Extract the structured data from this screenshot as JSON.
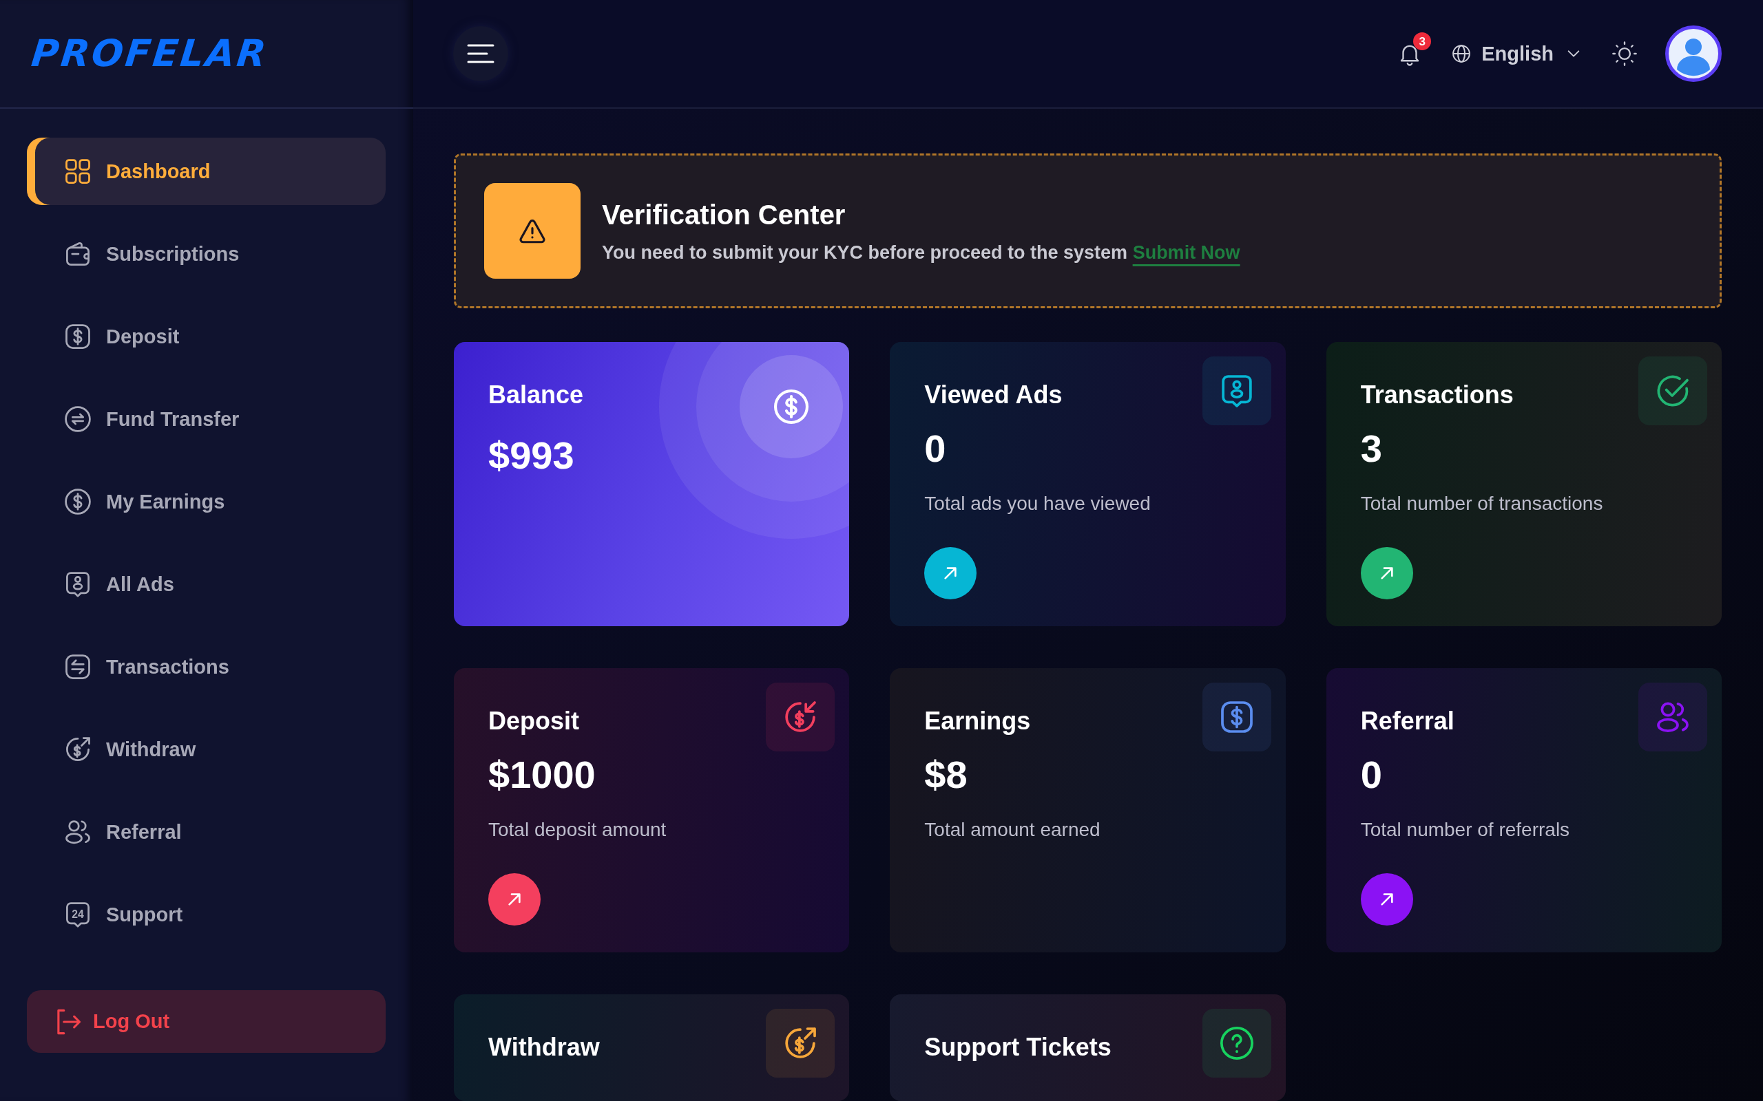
{
  "sidebar": {
    "logo": "PROFELAR",
    "items": [
      {
        "label": "Dashboard",
        "selected": true
      },
      {
        "label": "Subscriptions",
        "selected": false
      },
      {
        "label": "Deposit",
        "selected": false
      },
      {
        "label": "Fund Transfer",
        "selected": false
      },
      {
        "label": "My Earnings",
        "selected": false
      },
      {
        "label": "All Ads",
        "selected": false
      },
      {
        "label": "Transactions",
        "selected": false
      },
      {
        "label": "Withdraw",
        "selected": false
      },
      {
        "label": "Referral",
        "selected": false
      },
      {
        "label": "Support",
        "selected": false,
        "icon_text": "24"
      }
    ],
    "logout": "Log Out"
  },
  "topbar": {
    "notification_count": "3",
    "language": "English"
  },
  "verification": {
    "title": "Verification Center",
    "message": "You need to submit your KYC before proceed to the system",
    "link": "Submit Now"
  },
  "cards": [
    {
      "kind": "balance",
      "title": "Balance",
      "value": "$993"
    },
    {
      "kind": "stat",
      "title": "Viewed Ads",
      "value": "0",
      "description": "Total ads you have viewed",
      "color": "#06b6d4",
      "arrow_button": true
    },
    {
      "kind": "stat",
      "title": "Transactions",
      "value": "3",
      "description": "Total number of transactions",
      "color": "#22b573",
      "arrow_button": true
    },
    {
      "kind": "stat",
      "title": "Deposit",
      "value": "$1000",
      "description": "Total deposit amount",
      "color": "#f43f5e",
      "arrow_button": true
    },
    {
      "kind": "stat",
      "title": "Earnings",
      "value": "$8",
      "description": "Total amount earned",
      "color": "#5b8def",
      "arrow_button": false
    },
    {
      "kind": "stat",
      "title": "Referral",
      "value": "0",
      "description": "Total number of referrals",
      "color": "#8b12f4",
      "arrow_button": true
    },
    {
      "kind": "stat",
      "title": "Withdraw",
      "color": "#f7a73a",
      "arrow_button": false
    },
    {
      "kind": "stat",
      "title": "Support Tickets",
      "color": "#17d35f",
      "arrow_button": false
    }
  ]
}
